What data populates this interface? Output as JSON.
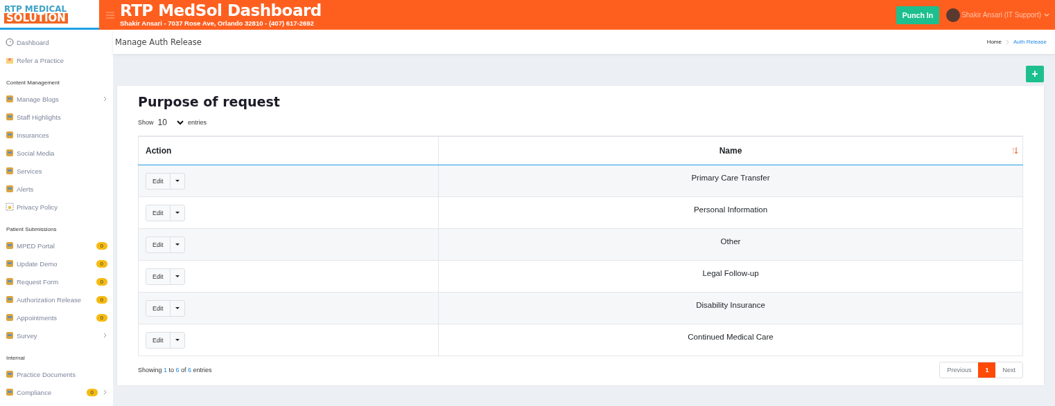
{
  "header": {
    "logo_line_1": "RTP MEDICAL",
    "logo_line_2": "SOLUTION",
    "title": "RTP MedSol Dashboard",
    "subtitle": "Shakir Ansari - 7037 Rose Ave, Orlando 32810 - (407) 617-2692",
    "punch_button": "Punch In",
    "user": "Shakir Ansari (IT Support)"
  },
  "sidebar": {
    "items": [
      {
        "kind": "item",
        "label": "Dashboard"
      },
      {
        "kind": "item",
        "label": "Refer a Practice"
      },
      {
        "kind": "section",
        "label": "Content Management"
      },
      {
        "kind": "item",
        "label": "Manage Blogs",
        "has_submenu": true
      },
      {
        "kind": "item",
        "label": "Staff Highlights"
      },
      {
        "kind": "item",
        "label": "Insurances"
      },
      {
        "kind": "item",
        "label": "Social Media"
      },
      {
        "kind": "item",
        "label": "Services"
      },
      {
        "kind": "item",
        "label": "Alerts"
      },
      {
        "kind": "item",
        "label": "Privacy Policy"
      },
      {
        "kind": "section",
        "label": "Patient Submissions"
      },
      {
        "kind": "item",
        "label": "MPED Portal",
        "badge": "0"
      },
      {
        "kind": "item",
        "label": "Update Demo",
        "badge": "0"
      },
      {
        "kind": "item",
        "label": "Request Form",
        "badge": "0"
      },
      {
        "kind": "item",
        "label": "Authorization Release",
        "badge": "0"
      },
      {
        "kind": "item",
        "label": "Appointments",
        "badge": "0"
      },
      {
        "kind": "item",
        "label": "Survey",
        "has_submenu": true
      },
      {
        "kind": "section",
        "label": "Internal"
      },
      {
        "kind": "item",
        "label": "Practice Documents"
      },
      {
        "kind": "item",
        "label": "Compliance",
        "badge": "0",
        "has_submenu": true
      }
    ]
  },
  "page_title": "Manage Auth Release",
  "breadcrumb": [
    {
      "label": "Home",
      "selected": false
    },
    {
      "label": "Auth Release",
      "selected": true
    }
  ],
  "add_button": "+",
  "card": {
    "title": "Purpose of request",
    "length": {
      "show": "Show",
      "value": "10",
      "entries": "entries"
    },
    "table": {
      "columns": [
        "Action",
        "Name"
      ],
      "rows": [
        {
          "action": "Edit",
          "name": "Primary Care Transfer"
        },
        {
          "action": "Edit",
          "name": "Personal Information"
        },
        {
          "action": "Edit",
          "name": "Other"
        },
        {
          "action": "Edit",
          "name": "Legal Follow-up"
        },
        {
          "action": "Edit",
          "name": "Disability Insurance"
        },
        {
          "action": "Edit",
          "name": "Continued Medical Care"
        }
      ]
    },
    "info": "Showing **1** to **6** of **6** entries",
    "pagination": [
      {
        "label": "Previous",
        "selected": false
      },
      {
        "label": "1",
        "selected": true
      },
      {
        "label": "Next",
        "selected": false
      }
    ]
  }
}
